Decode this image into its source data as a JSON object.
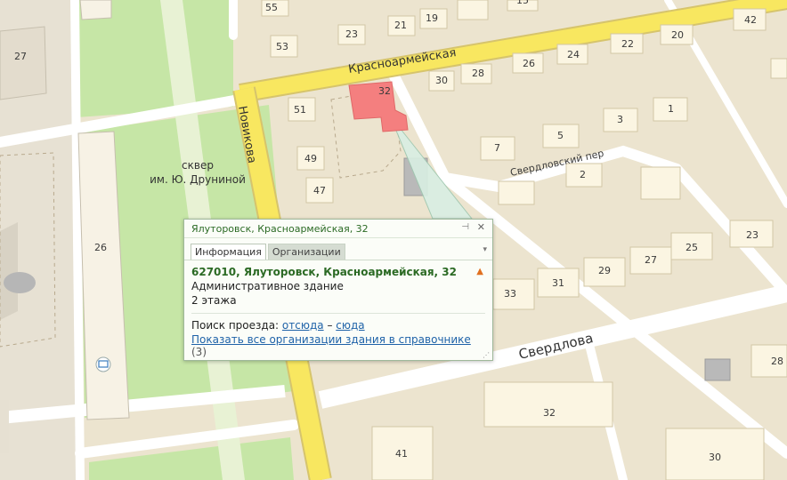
{
  "map": {
    "streets": {
      "krasnoarmeyskaya": "Красноармейская",
      "novikova": "Новикова",
      "sverdlova": "Свердлова",
      "sverdlovsky_per": "Свердловский пер"
    },
    "park": {
      "line1": "сквер",
      "line2": "им. Ю. Друниной"
    },
    "houses": {
      "h55": "55",
      "h53": "53",
      "h23a": "23",
      "h21": "21",
      "h19": "19",
      "h15": "15",
      "h27w": "27",
      "h51": "51",
      "h49": "49",
      "h47": "47",
      "h26w": "26",
      "h32sel": "32",
      "h30": "30",
      "h28": "28",
      "h26": "26",
      "h24": "24",
      "h22": "22",
      "h20": "20",
      "h42": "42",
      "h3": "3",
      "h1": "1",
      "h7": "7",
      "h5": "5",
      "h2": "2",
      "h23b": "23",
      "h25": "25",
      "h27": "27",
      "h29": "29",
      "h31": "31",
      "h33": "33",
      "h28b": "28",
      "h32b": "32",
      "h41": "41",
      "h30b": "30"
    },
    "colors": {
      "selected_building": "#f47f7f",
      "main_road": "#f8e760",
      "park_green": "#c6e6a6",
      "background": "#ece4cf"
    }
  },
  "popup": {
    "header_title": "Ялуторовск, Красноармейская, 32",
    "pin_icon": "⊣",
    "close_icon": "✕",
    "tabs": [
      "Информация",
      "Организации"
    ],
    "menu_icon": "▾",
    "address": "627010, Ялуторовск, Красноармейская, 32",
    "warning_icon": "▲",
    "building_type": "Административное здание",
    "floors": "2 этажа",
    "route_prefix": "Поиск проезда:",
    "route_from": "отсюда",
    "route_dash": "–",
    "route_to": "сюда",
    "orgs_link": "Показать все организации здания в справочнике",
    "orgs_count": "(3)"
  }
}
